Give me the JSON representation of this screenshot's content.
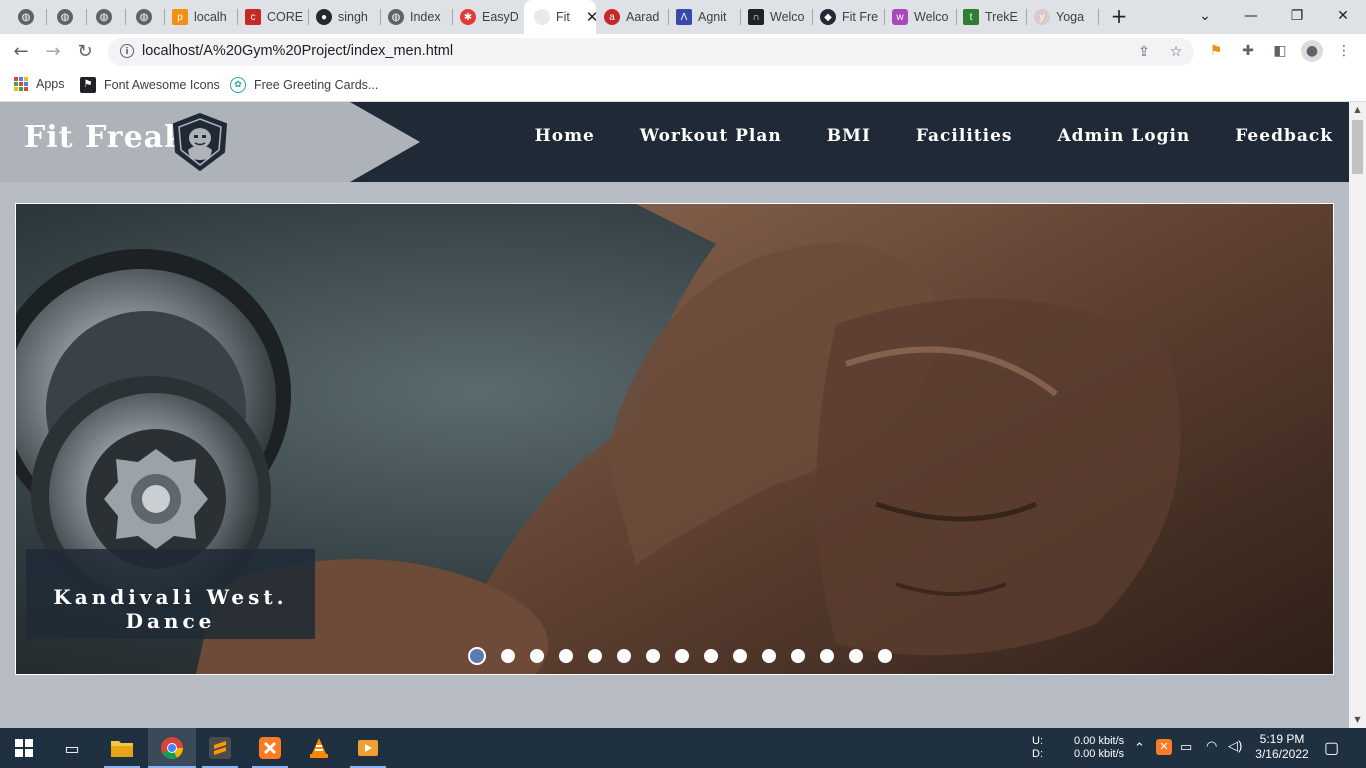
{
  "browser": {
    "tabs": [
      {
        "label": "",
        "icon": "globe-icon"
      },
      {
        "label": "",
        "icon": "globe-icon"
      },
      {
        "label": "",
        "icon": "globe-icon"
      },
      {
        "label": "",
        "icon": "globe-icon"
      },
      {
        "label": "localh",
        "icon": "phpmyadmin-icon"
      },
      {
        "label": "CORE",
        "icon": "core-icon"
      },
      {
        "label": "singh",
        "icon": "github-icon"
      },
      {
        "label": "Index",
        "icon": "globe-icon"
      },
      {
        "label": "EasyD",
        "icon": "easyd-icon"
      },
      {
        "label": "Fit",
        "icon": "blank-icon",
        "active": true
      },
      {
        "label": "Aarad",
        "icon": "aarad-icon"
      },
      {
        "label": "Agnit",
        "icon": "agnit-icon"
      },
      {
        "label": "Welco",
        "icon": "arch-icon"
      },
      {
        "label": "Fit Fre",
        "icon": "gym-icon"
      },
      {
        "label": "Welco",
        "icon": "purple-icon"
      },
      {
        "label": "TrekE",
        "icon": "trek-icon"
      },
      {
        "label": "Yoga",
        "icon": "yoga-icon"
      }
    ],
    "url": "localhost/A%20Gym%20Project/index_men.html",
    "bookmarks": [
      {
        "label": "Apps"
      },
      {
        "label": "Font Awesome Icons"
      },
      {
        "label": "Free Greeting Cards..."
      }
    ]
  },
  "site": {
    "brand": "Fit Freak",
    "nav": [
      "Home",
      "Workout Plan",
      "BMI",
      "Facilities",
      "Admin Login",
      "Feedback"
    ],
    "slider": {
      "caption": "Kandivali West. Dance",
      "slide_count": 15,
      "active_slide": 1
    }
  },
  "taskbar": {
    "net_up_label": "U:",
    "net_down_label": "D:",
    "net_up": "0.00 kbit/s",
    "net_down": "0.00 kbit/s",
    "time": "5:19 PM",
    "date": "3/16/2022"
  },
  "colors": {
    "header_bg": "#1f2a36",
    "logo_band": "#aeb3ba",
    "page_bg": "#b7bcc4",
    "slider_dot_active": "#5a7bb5"
  }
}
